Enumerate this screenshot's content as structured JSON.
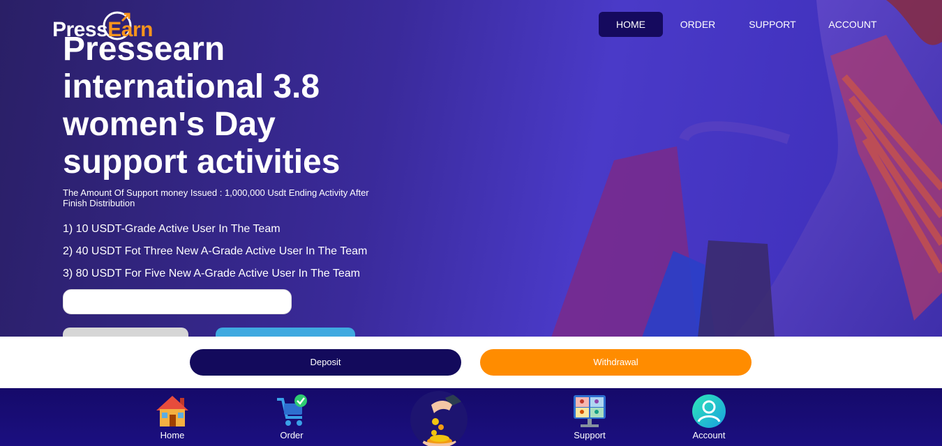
{
  "brand": {
    "name_part1": "Pre",
    "name_part2": "s",
    "name_part3": "s",
    "name_part4": "Earn"
  },
  "nav": {
    "home": "HOME",
    "order": "ORDER",
    "support": "SUPPORT",
    "account": "ACCOUNT"
  },
  "hero": {
    "headline": "Pressearn international 3.8 women's Day support activities",
    "subline": "The Amount Of Support money Issued : 1,000,000 Usdt Ending Activity After Finish Distribution",
    "items": [
      "1) 10 USDT-Grade Active User In The Team",
      "2) 40 USDT Fot Three New A-Grade Active User In The Team",
      "3) 80 USDT For Five New A-Grade Active User In The Team"
    ]
  },
  "actions": {
    "deposit": "Deposit",
    "withdrawal": "Withdrawal"
  },
  "bottom_nav": {
    "home": "Home",
    "order": "Order",
    "support": "Support",
    "account": "Account"
  },
  "colors": {
    "accent": "#f7941d",
    "primary": "#130a5c",
    "withdraw": "#ff8c00"
  },
  "icons": [
    "house-icon",
    "cart-icon",
    "coins-hand-icon",
    "video-meeting-icon",
    "user-icon"
  ]
}
